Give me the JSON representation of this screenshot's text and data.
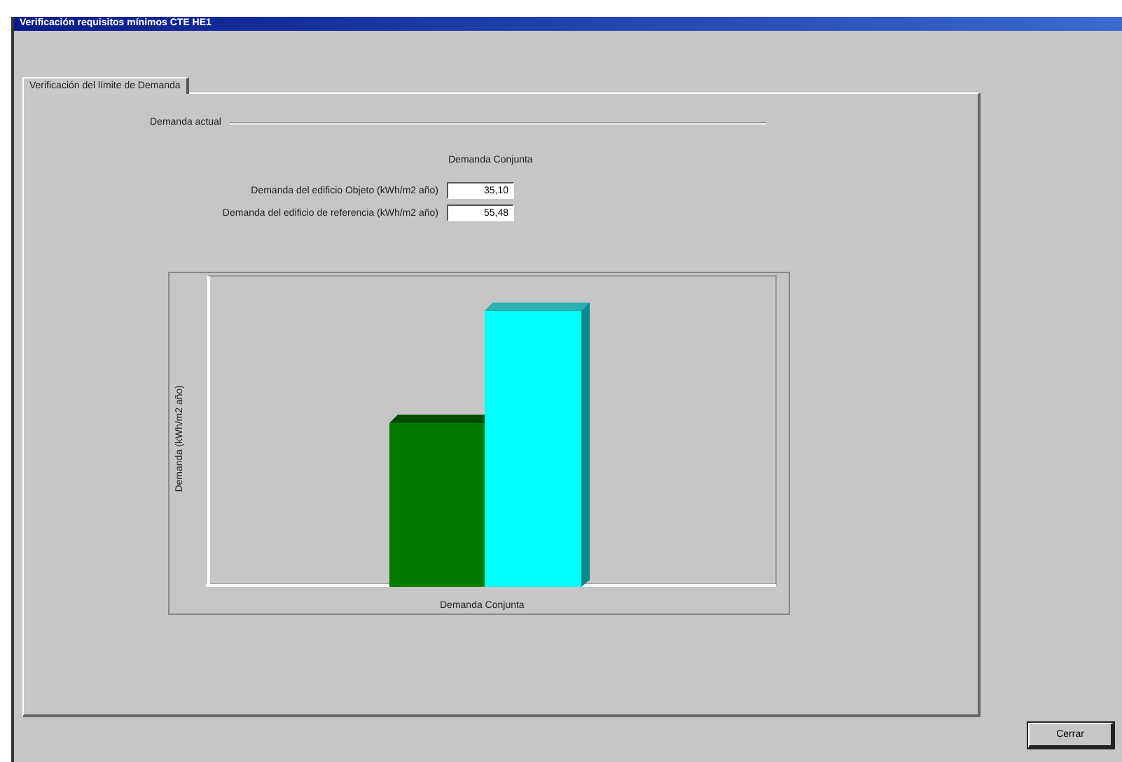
{
  "window": {
    "title": "Verificación requisitos mínimos CTE HE1"
  },
  "tabs": [
    {
      "label": "Verificación del límite de Demanda",
      "selected": true
    }
  ],
  "group": {
    "title": "Demanda actual"
  },
  "column_heading": "Demanda Conjunta",
  "fields": [
    {
      "label": "Demanda del edificio Objeto (kWh/m2 año)",
      "value": "35,10"
    },
    {
      "label": "Demanda del edificio de referencia (kWh/m2 año)",
      "value": "55,48"
    }
  ],
  "chart": {
    "ylabel": "Demanda (kWh/m2 año)",
    "xlabel": "Demanda Conjunta"
  },
  "buttons": [
    {
      "label": "Cerrar"
    }
  ]
}
